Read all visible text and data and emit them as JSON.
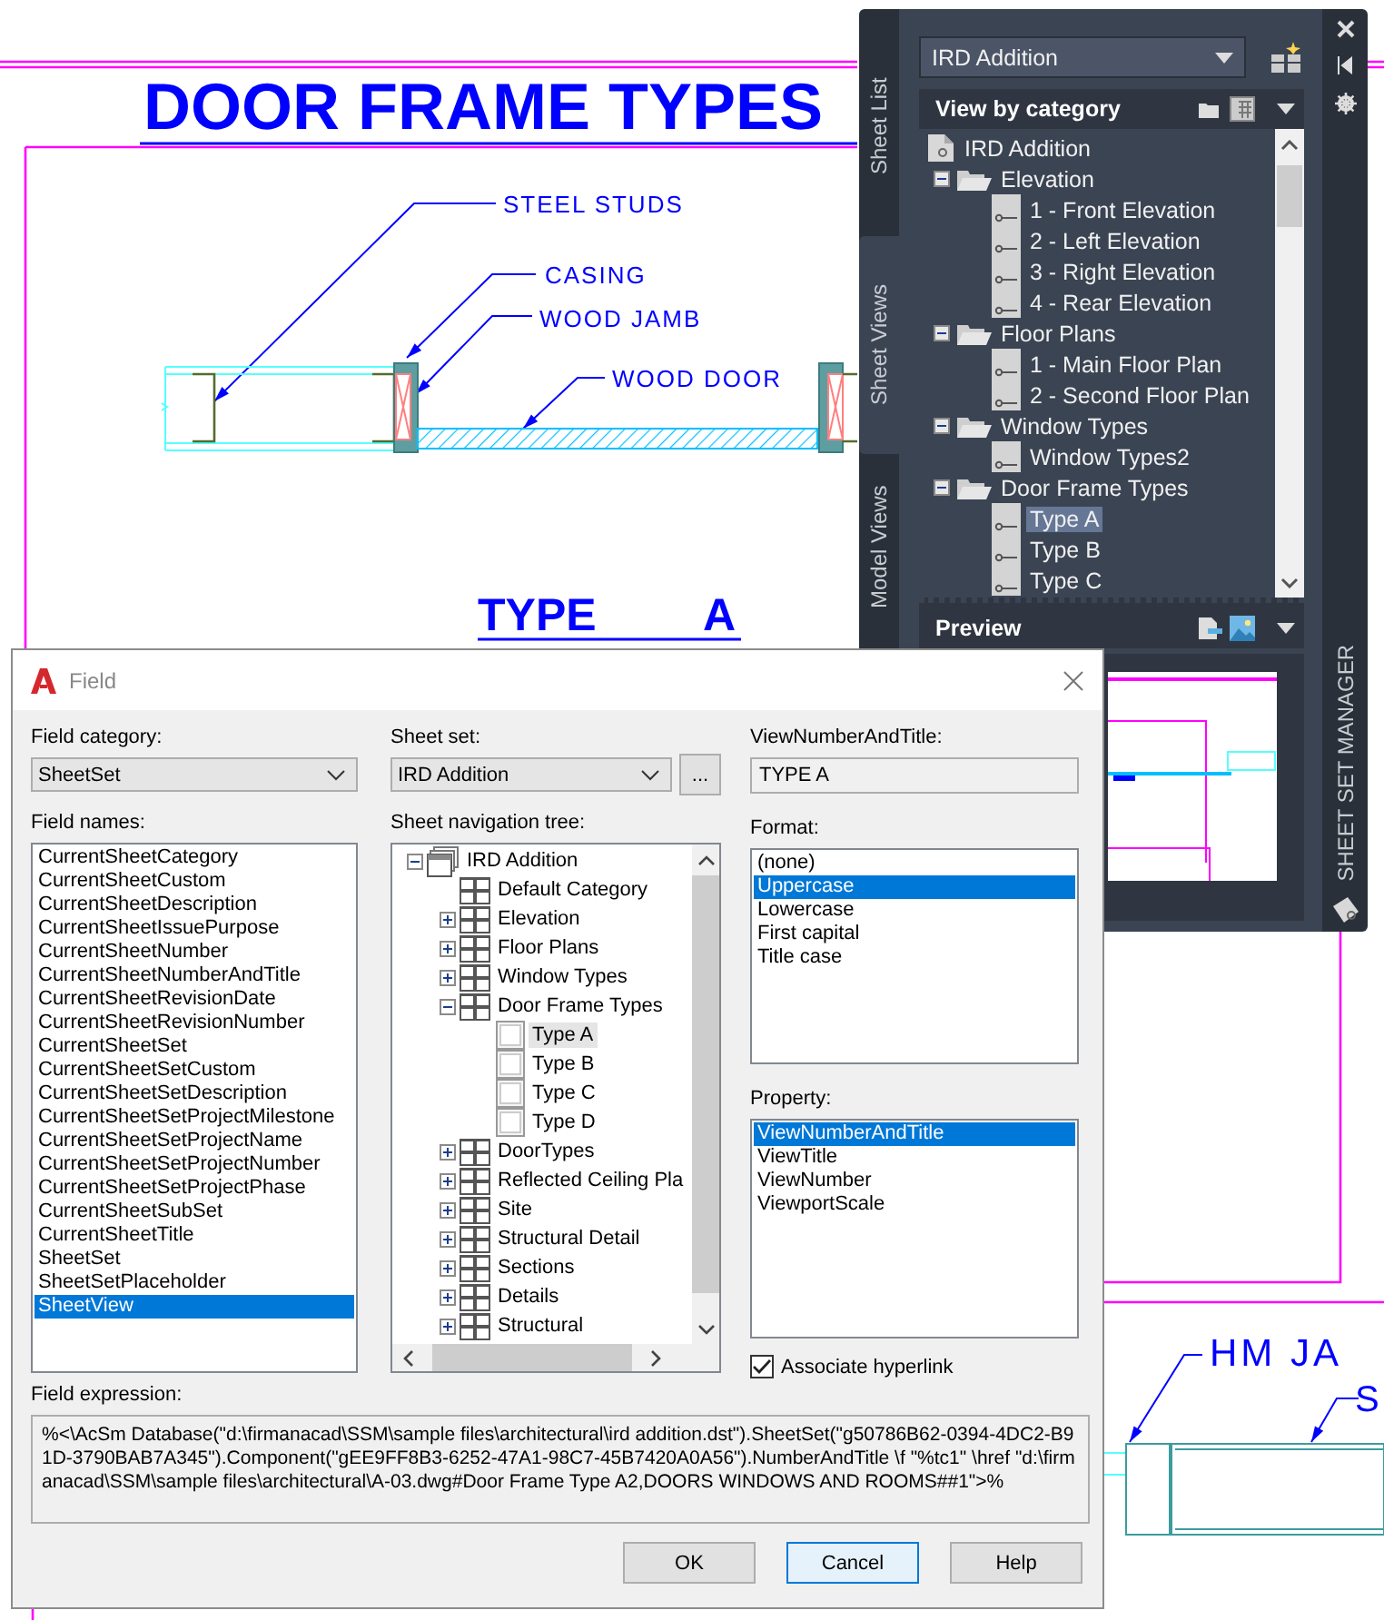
{
  "drawing": {
    "title": "DOOR FRAME TYPES",
    "callouts": [
      "STEEL STUDS",
      "CASING",
      "WOOD JAMB",
      "WOOD DOOR"
    ],
    "view_label": "TYPE",
    "view_number": "A",
    "detail_callouts": [
      "HM JA",
      "S"
    ]
  },
  "sheet_set_manager": {
    "title": "SHEET SET MANAGER",
    "tabs": [
      {
        "label": "Sheet List",
        "selected": false
      },
      {
        "label": "Sheet Views",
        "selected": true
      },
      {
        "label": "Model Views",
        "selected": false
      }
    ],
    "sheet_set": "IRD Addition",
    "view_mode": "View by category",
    "tree": [
      {
        "kind": "sheet_set",
        "label": "IRD Addition",
        "selected": false,
        "children": [
          {
            "kind": "category",
            "label": "Elevation",
            "expanded": true,
            "selected": false,
            "children": [
              {
                "kind": "view",
                "label": "1 - Front Elevation",
                "selected": false
              },
              {
                "kind": "view",
                "label": "2 - Left Elevation",
                "selected": false
              },
              {
                "kind": "view",
                "label": "3 - Right Elevation",
                "selected": false
              },
              {
                "kind": "view",
                "label": "4 - Rear Elevation",
                "selected": false
              }
            ]
          },
          {
            "kind": "category",
            "label": "Floor Plans",
            "expanded": true,
            "selected": false,
            "children": [
              {
                "kind": "view",
                "label": "1 - Main Floor Plan",
                "selected": false
              },
              {
                "kind": "view",
                "label": "2 - Second Floor Plan",
                "selected": false
              }
            ]
          },
          {
            "kind": "category",
            "label": "Window Types",
            "expanded": true,
            "selected": false,
            "children": [
              {
                "kind": "view",
                "label": "Window Types2",
                "selected": false
              }
            ]
          },
          {
            "kind": "category",
            "label": "Door Frame Types",
            "expanded": true,
            "selected": false,
            "children": [
              {
                "kind": "view",
                "label": "Type A",
                "selected": true
              },
              {
                "kind": "view",
                "label": "Type B",
                "selected": false
              },
              {
                "kind": "view",
                "label": "Type C",
                "selected": false
              }
            ]
          }
        ]
      }
    ],
    "preview_label": "Preview"
  },
  "field_dialog": {
    "title": "Field",
    "field_category": {
      "label": "Field category:",
      "value": "SheetSet"
    },
    "field_names": {
      "label": "Field names:",
      "items": [
        {
          "text": "CurrentSheetCategory",
          "selected": false
        },
        {
          "text": "CurrentSheetCustom",
          "selected": false
        },
        {
          "text": "CurrentSheetDescription",
          "selected": false
        },
        {
          "text": "CurrentSheetIssuePurpose",
          "selected": false
        },
        {
          "text": "CurrentSheetNumber",
          "selected": false
        },
        {
          "text": "CurrentSheetNumberAndTitle",
          "selected": false
        },
        {
          "text": "CurrentSheetRevisionDate",
          "selected": false
        },
        {
          "text": "CurrentSheetRevisionNumber",
          "selected": false
        },
        {
          "text": "CurrentSheetSet",
          "selected": false
        },
        {
          "text": "CurrentSheetSetCustom",
          "selected": false
        },
        {
          "text": "CurrentSheetSetDescription",
          "selected": false
        },
        {
          "text": "CurrentSheetSetProjectMilestone",
          "selected": false
        },
        {
          "text": "CurrentSheetSetProjectName",
          "selected": false
        },
        {
          "text": "CurrentSheetSetProjectNumber",
          "selected": false
        },
        {
          "text": "CurrentSheetSetProjectPhase",
          "selected": false
        },
        {
          "text": "CurrentSheetSubSet",
          "selected": false
        },
        {
          "text": "CurrentSheetTitle",
          "selected": false
        },
        {
          "text": "SheetSet",
          "selected": false
        },
        {
          "text": "SheetSetPlaceholder",
          "selected": false
        },
        {
          "text": "SheetView",
          "selected": true
        }
      ]
    },
    "sheet_set": {
      "label": "Sheet set:",
      "value": "IRD Addition",
      "browse": "..."
    },
    "navigation_tree": {
      "label": "Sheet navigation tree:",
      "items": [
        {
          "kind": "sheet_set",
          "label": "IRD Addition",
          "expanded": true,
          "selected": false,
          "children": [
            {
              "kind": "category",
              "label": "Default Category",
              "selected": false
            },
            {
              "kind": "category",
              "label": "Elevation",
              "expanded": false,
              "selected": false
            },
            {
              "kind": "category",
              "label": "Floor Plans",
              "expanded": false,
              "selected": false
            },
            {
              "kind": "category",
              "label": "Window Types",
              "expanded": false,
              "selected": false
            },
            {
              "kind": "category",
              "label": "Door Frame Types",
              "expanded": true,
              "selected": false,
              "children": [
                {
                  "kind": "view",
                  "label": "Type A",
                  "selected": true
                },
                {
                  "kind": "view",
                  "label": "Type B",
                  "selected": false
                },
                {
                  "kind": "view",
                  "label": "Type C",
                  "selected": false
                },
                {
                  "kind": "view",
                  "label": "Type D",
                  "selected": false
                }
              ]
            },
            {
              "kind": "category",
              "label": "DoorTypes",
              "expanded": false,
              "selected": false
            },
            {
              "kind": "category",
              "label": "Reflected Ceiling Pla",
              "expanded": false,
              "selected": false
            },
            {
              "kind": "category",
              "label": "Site",
              "expanded": false,
              "selected": false
            },
            {
              "kind": "category",
              "label": "Structural Detail",
              "expanded": false,
              "selected": false
            },
            {
              "kind": "category",
              "label": "Sections",
              "expanded": false,
              "selected": false
            },
            {
              "kind": "category",
              "label": "Details",
              "expanded": false,
              "selected": false
            },
            {
              "kind": "category",
              "label": "Structural",
              "expanded": false,
              "selected": false
            }
          ]
        }
      ]
    },
    "value_field": {
      "label": "ViewNumberAndTitle:",
      "value": "TYPE A"
    },
    "format": {
      "label": "Format:",
      "items": [
        {
          "text": "(none)",
          "selected": false
        },
        {
          "text": "Uppercase",
          "selected": true
        },
        {
          "text": "Lowercase",
          "selected": false
        },
        {
          "text": "First capital",
          "selected": false
        },
        {
          "text": "Title case",
          "selected": false
        }
      ]
    },
    "property": {
      "label": "Property:",
      "items": [
        {
          "text": "ViewNumberAndTitle",
          "selected": true
        },
        {
          "text": "ViewTitle",
          "selected": false
        },
        {
          "text": "ViewNumber",
          "selected": false
        },
        {
          "text": "ViewportScale",
          "selected": false
        }
      ]
    },
    "associate_hyperlink": {
      "label": "Associate hyperlink",
      "checked": true
    },
    "expression": {
      "label": "Field expression:",
      "value": "%<\\AcSm Database(\"d:\\firmanacad\\SSM\\sample files\\architectural\\ird addition.dst\").SheetSet(\"g50786B62-0394-4DC2-B91D-3790BAB7A345\").Component(\"gEE9FF8B3-6252-47A1-98C7-45B7420A0A56\").NumberAndTitle \\f \"%tc1\" \\href \"d:\\firmanacad\\SSM\\sample files\\architectural\\A-03.dwg#Door Frame Type A2,DOORS WINDOWS AND ROOMS##1\">%"
    },
    "buttons": [
      {
        "label": "OK",
        "focused": false
      },
      {
        "label": "Cancel",
        "focused": true
      },
      {
        "label": "Help",
        "focused": false
      }
    ]
  }
}
